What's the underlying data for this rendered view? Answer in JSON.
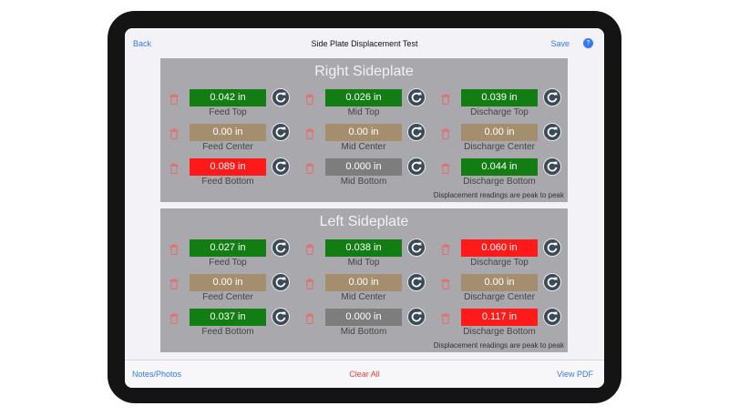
{
  "nav": {
    "back": "Back",
    "title": "Side Plate Displacement Test",
    "save": "Save",
    "help_icon": "speaker-help-icon"
  },
  "colors": {
    "green": "#127d12",
    "tan": "#a58e6d",
    "red": "#ff1a1a",
    "gray": "#7d7d7d",
    "panel": "#a9a8ad"
  },
  "right": {
    "title": "Right Sideplate",
    "cells": [
      {
        "value": "0.042 in",
        "label": "Feed Top",
        "status": "green"
      },
      {
        "value": "0.026 in",
        "label": "Mid Top",
        "status": "green"
      },
      {
        "value": "0.039 in",
        "label": "Discharge Top",
        "status": "green"
      },
      {
        "value": "0.00 in",
        "label": "Feed Center",
        "status": "tan"
      },
      {
        "value": "0.00 in",
        "label": "Mid Center",
        "status": "tan"
      },
      {
        "value": "0.00 in",
        "label": "Discharge Center",
        "status": "tan"
      },
      {
        "value": "0.089 in",
        "label": "Feed Bottom",
        "status": "red"
      },
      {
        "value": "0.000 in",
        "label": "Mid Bottom",
        "status": "gray"
      },
      {
        "value": "0.044 in",
        "label": "Discharge Bottom",
        "status": "green"
      }
    ],
    "note": "Displacement readings are peak to peak"
  },
  "left": {
    "title": "Left Sideplate",
    "cells": [
      {
        "value": "0.027 in",
        "label": "Feed Top",
        "status": "green"
      },
      {
        "value": "0.038 in",
        "label": "Mid Top",
        "status": "green"
      },
      {
        "value": "0.060 in",
        "label": "Discharge Top",
        "status": "red"
      },
      {
        "value": "0.00 in",
        "label": "Feed Center",
        "status": "tan"
      },
      {
        "value": "0.00 in",
        "label": "Mid Center",
        "status": "tan"
      },
      {
        "value": "0.00 in",
        "label": "Discharge Center",
        "status": "tan"
      },
      {
        "value": "0.037 in",
        "label": "Feed Bottom",
        "status": "green"
      },
      {
        "value": "0.000 in",
        "label": "Mid Bottom",
        "status": "gray"
      },
      {
        "value": "0.117 in",
        "label": "Discharge Bottom",
        "status": "red"
      }
    ],
    "note": "Displacement readings are peak to peak"
  },
  "bottom": {
    "notes": "Notes/Photos",
    "clear": "Clear All",
    "pdf": "View PDF"
  }
}
